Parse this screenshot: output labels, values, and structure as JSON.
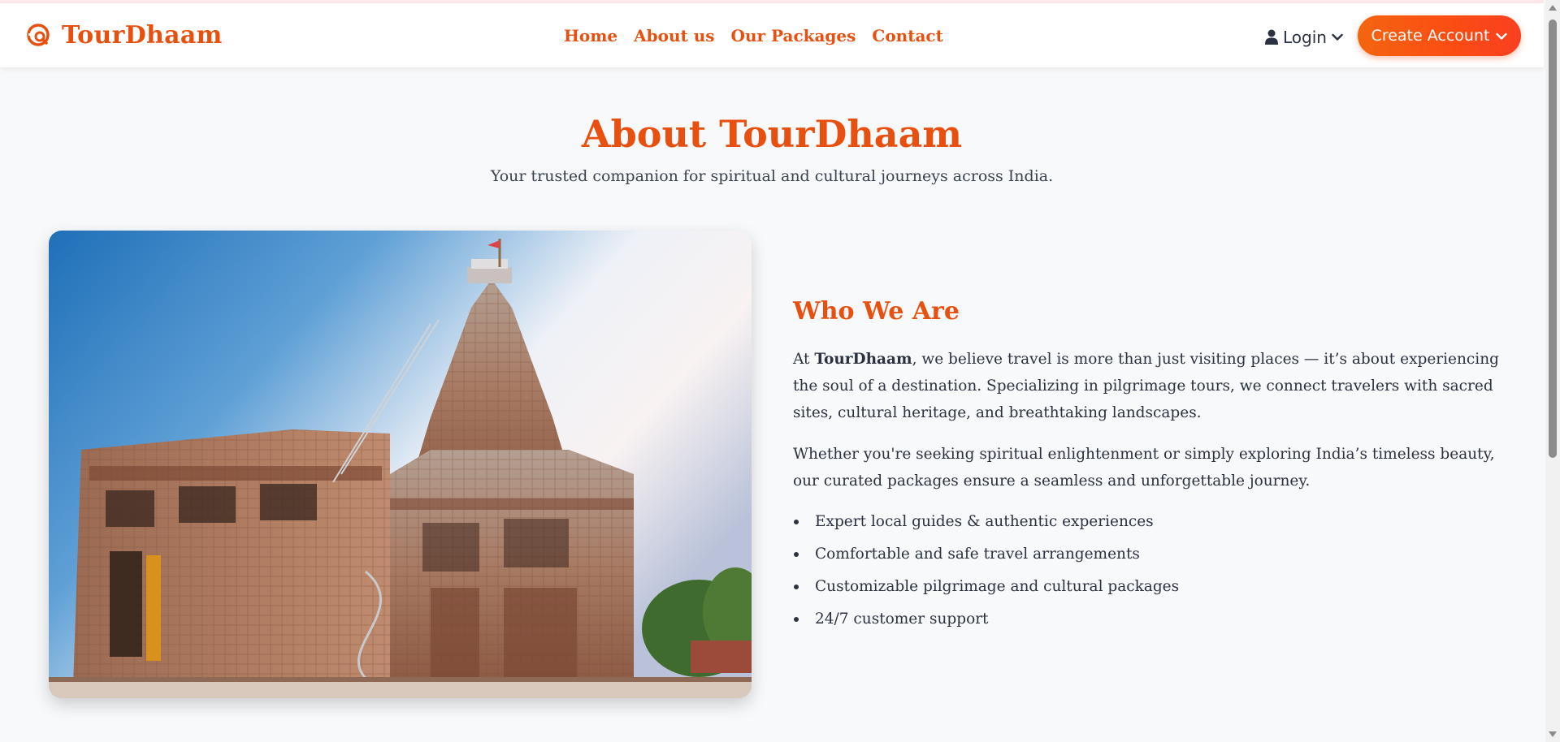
{
  "brand": {
    "name": "TourDhaam",
    "icon": "map-search-icon",
    "accent_color": "#e8500f"
  },
  "nav": {
    "items": [
      {
        "label": "Home"
      },
      {
        "label": "About us"
      },
      {
        "label": "Our Packages"
      },
      {
        "label": "Contact"
      }
    ]
  },
  "header_actions": {
    "login_label": "Login",
    "login_icon": "user-icon",
    "create_account_label": "Create Account",
    "button_gradient": [
      "#f4650f",
      "#f93f20"
    ]
  },
  "hero": {
    "title": "About TourDhaam",
    "subtitle": "Your trusted companion for spiritual and cultural journeys across India."
  },
  "about": {
    "image_subject": "temple-photo",
    "heading": "Who We Are",
    "p1_prefix": "At ",
    "p1_brand": "TourDhaam",
    "p1_rest": ", we believe travel is more than just visiting places — it’s about experiencing the soul of a destination. Specializing in pilgrimage tours, we connect travelers with sacred sites, cultural heritage, and breathtaking landscapes.",
    "p2": "Whether you're seeking spiritual enlightenment or simply exploring India’s timeless beauty, our curated packages ensure a seamless and unforgettable journey.",
    "features": [
      "Expert local guides & authentic experiences",
      "Comfortable and safe travel arrangements",
      "Customizable pilgrimage and cultural packages",
      "24/7 customer support"
    ]
  }
}
